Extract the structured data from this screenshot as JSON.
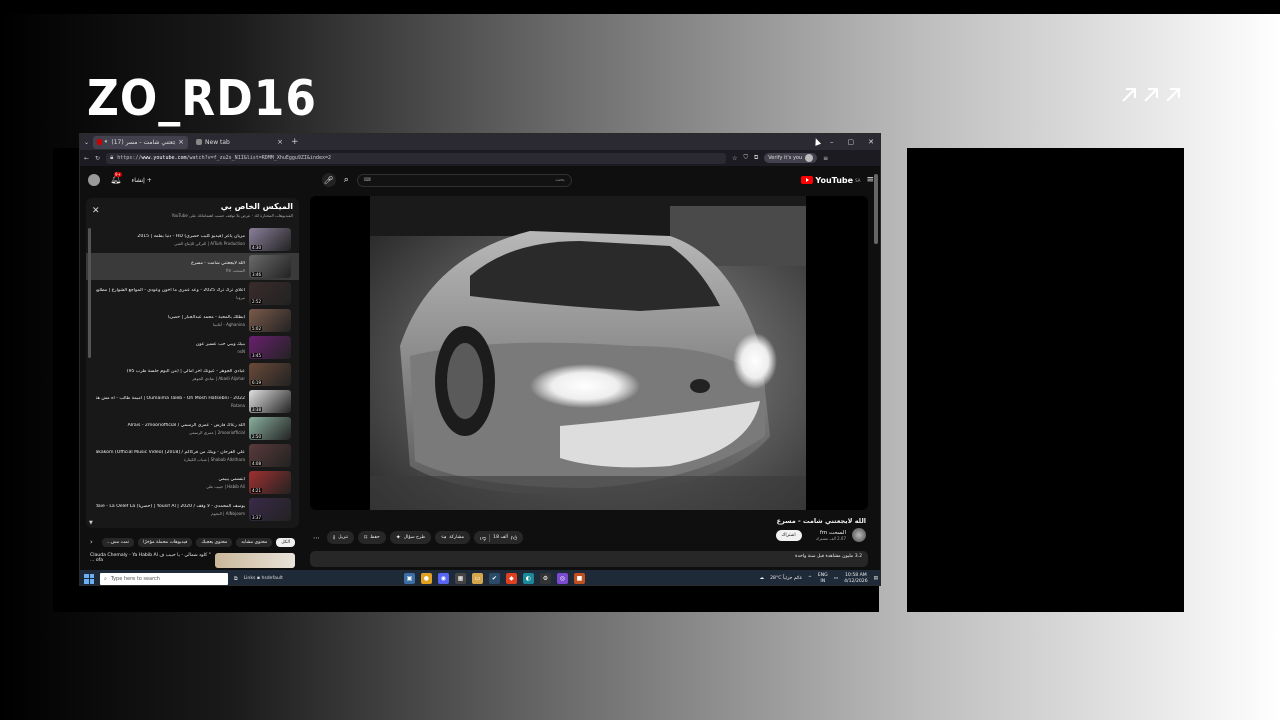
{
  "overlay": {
    "brand": "ZO_RD16"
  },
  "browser": {
    "tabs": [
      {
        "label": "(17) الله لايجعتني شامت - مسر"
      },
      {
        "label": "New tab"
      }
    ],
    "url_prefix": "https://",
    "url_host": "www.youtube.com",
    "url_rest": "/watch?v=f_zu2s_N1I&list=RDMM_XhuEggu9ZI&index=2",
    "verify_label": "Verify it's you"
  },
  "youtube": {
    "notifications_count": "9+",
    "create_label": "إنشاء",
    "search_placeholder": "بحث",
    "logo_text": "YouTube",
    "logo_country": "SA",
    "playlist": {
      "title": "الميكس الخاص بي",
      "subtitle": "الفيديوهات المختارة لك · عرض بلا توقف حسب اهتماماتك على YouTube",
      "items": [
        {
          "title": "مزيان ياعز (فيديو كليب حصري) HD - دنيا بطمه | 2015",
          "channel": "AlTurk Production | التركي للإنتاج الفني",
          "duration": "4:30",
          "thumb": "#8a7f9a"
        },
        {
          "title": "الله لايجعتني شامت - مسرع",
          "channel": "السحت fm",
          "duration": "3:46",
          "thumb": "#6a6a6a"
        },
        {
          "title": "اعلاي ترك ترك 2025 - وعد عمري ما اخون وعودي - المواجع الشوارع | مطلوبه اكثر شيء",
          "channel": "نيرونا",
          "duration": "2:52",
          "thumb": "#3a2b2b"
        },
        {
          "title": "ابطلك بالمحبة - محمد عبدالجبار | حصريا",
          "channel": "Aghanina - أغانينا",
          "duration": "5:02",
          "thumb": "#7a5a4a"
        },
        {
          "title": "ببيك وببي حب عسير عون",
          "channel": "nsN",
          "duration": "3:45",
          "thumb": "#6a2070"
        },
        {
          "title": "عبادي الجوهر - عيونك آخر آمالي | (من ألبوم جلسة طرب 95)",
          "channel": "Abadi Aljohar | عبادي الجوهر",
          "duration": "6:19",
          "thumb": "#6a4a3a"
        },
        {
          "title": "Oumaima Taleb - Oh Mosh Hatsebni - 2022 | أميمة طالب - أه مش هتسيبني",
          "channel": "Rotana",
          "duration": "3:38",
          "thumb": "#e0e0e0"
        },
        {
          "title": "الله رعاك فارس - عمري الرسمي / Alrais - 2mooriofficial",
          "channel": "2mooriofficial | عمري الرسمي",
          "duration": "2:50",
          "thumb": "#8ab0a0"
        },
        {
          "title": "علي الفرحان - وينك من فركاكم / Ali Alforati - Wanayt Man Fourakakom (Official Music Video) [2018]",
          "channel": "Shabab Alkithara | شباب الكيثارة",
          "duration": "4:08",
          "thumb": "#5a3a3a"
        },
        {
          "title": "ابتسمي يبيمي",
          "channel": "Habib Ali | حبيب علي",
          "duration": "4:21",
          "thumb": "#a03030"
        },
        {
          "title": "يوسف المحمدي - لا وقف / Yousif Al | 2020 | (حصريا) Sumaidaie - La Oelef La",
          "channel": "AlNojoom | النجوم",
          "duration": "3:37",
          "thumb": "#3a2a4a"
        }
      ]
    },
    "chips": [
      {
        "label": "الكل",
        "selected": true
      },
      {
        "label": "محتوى مشابه",
        "selected": false
      },
      {
        "label": "محتوى يعجبك",
        "selected": false
      },
      {
        "label": "فيديوهات محملة مؤخرًا",
        "selected": false
      },
      {
        "label": "تمت مش...",
        "selected": false
      }
    ],
    "recommended": {
      "title": "Clauda Chemaly - Ya Habib Al كلود شمالي - يا حبيب ف \" ... ofa"
    },
    "video": {
      "title": "الله لايجعتني شامت - مسرع",
      "channel": "السحت fm",
      "subscribers": "2.07 ألف مشترك",
      "subscribe_label": "اشتراك",
      "likes": "18 ألف",
      "share_label": "مشاركة",
      "ask_label": "طرح سؤال",
      "save_label": "حفظ",
      "download_label": "تنزيل",
      "description": "3.2 مليون مشاهدة قبل سنة واحدة"
    }
  },
  "taskbar": {
    "search_placeholder": "Type here to search",
    "links_label": "Links",
    "links_extra": "hsdefault",
    "weather": "28°C غائم جزئياً",
    "lang_top": "ENG",
    "lang_bottom": "IN",
    "time": "10:58 AM",
    "date": "4/12/2026"
  }
}
